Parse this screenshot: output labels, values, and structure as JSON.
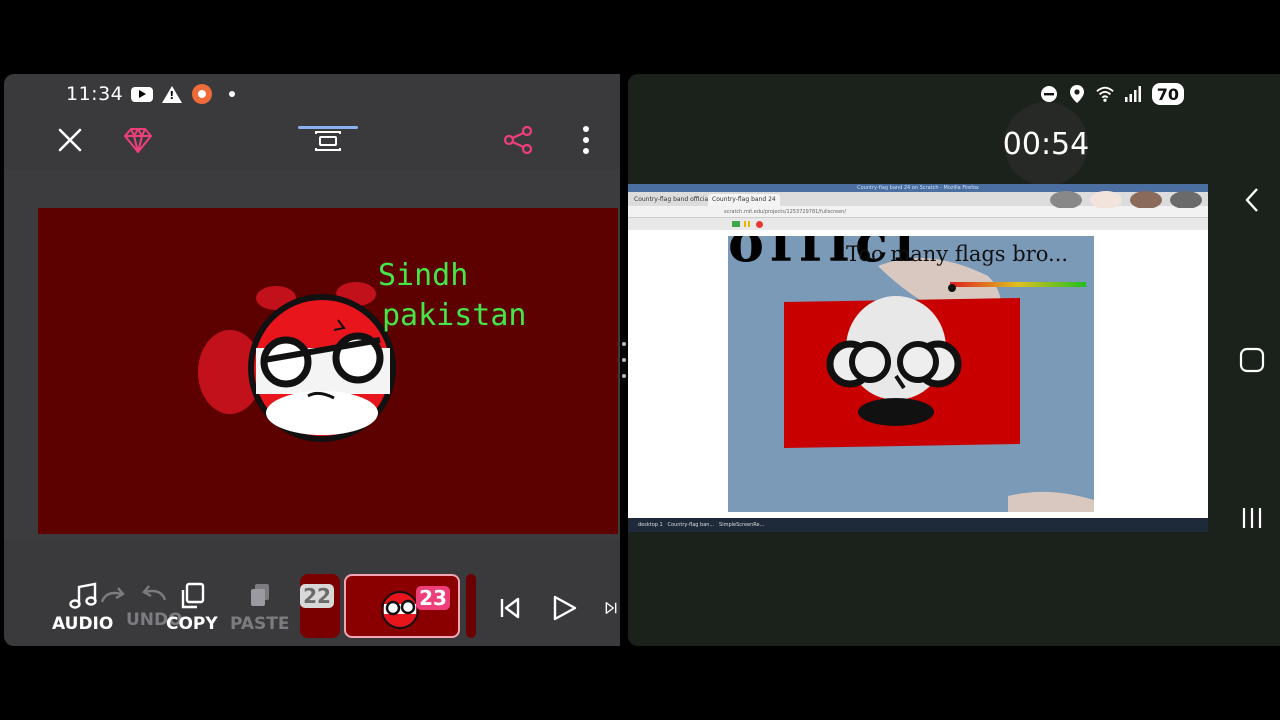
{
  "left_app": {
    "status_bar": {
      "time": "11:34"
    },
    "canvas": {
      "background_color": "#5c0000",
      "caption_line1": "Sindh",
      "caption_line2": "pakistan",
      "caption_color": "#45e645"
    },
    "toolbar": {
      "audio_label": "AUDIO",
      "undo_label": "UNDO",
      "copy_label": "COPY",
      "paste_label": "PASTE"
    },
    "timeline": {
      "prev_frame_number": "22",
      "current_frame_number": "23",
      "current_frame_color": "#ee3f7a"
    }
  },
  "right_app": {
    "status_bar": {
      "battery": "70"
    },
    "recording_timer": "00:54",
    "browser": {
      "title": "Country-flag band 24 on Scratch - Mozilla Firefox",
      "tab1_label": "Country-flag band officia",
      "tab2_label": "Country-flag band 24",
      "url": "scratch.mit.edu/projects/1253729781/fullscreen/"
    },
    "scratch_stage": {
      "caption": "Too many flags bro...",
      "flag_color": "#c80000"
    },
    "taskbar": {
      "start": "desktop 1",
      "task1": "Country-flag ban...",
      "task2": "SimpleScreenRe..."
    }
  }
}
